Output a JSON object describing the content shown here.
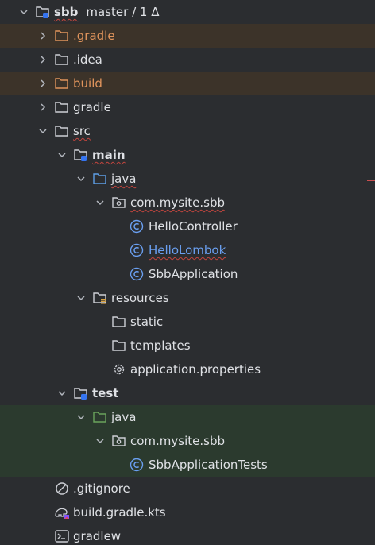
{
  "project": {
    "name": "sbb",
    "branch": "master / 1 Δ"
  },
  "items": {
    "gradle_hidden": ".gradle",
    "idea": ".idea",
    "build": "build",
    "gradle": "gradle",
    "src": "src",
    "main": "main",
    "main_java": "java",
    "main_pkg": "com.mysite.sbb",
    "hello_controller": "HelloController",
    "hello_lombok": "HelloLombok",
    "sbb_application": "SbbApplication",
    "resources": "resources",
    "static": "static",
    "templates": "templates",
    "app_props": "application.properties",
    "test": "test",
    "test_java": "java",
    "test_pkg": "com.mysite.sbb",
    "sbb_tests": "SbbApplicationTests",
    "gitignore": ".gitignore",
    "build_gradle": "build.gradle.kts",
    "gradlew": "gradlew"
  },
  "colors": {
    "background": "#2b2d30",
    "excluded_bg": "#3c3329",
    "test_bg": "#2b3a2e",
    "excluded_text": "#e0945c",
    "class_icon": "#6a9ff0",
    "source_folder": "#5e9ee6",
    "test_folder": "#6aa35c"
  },
  "icons": {
    "folder": "folder-icon",
    "module": "module-icon",
    "package": "package-icon",
    "class": "class-icon",
    "settings": "gear-icon",
    "ignore": "ignore-icon",
    "gradle_file": "gradle-icon",
    "terminal": "terminal-icon"
  }
}
